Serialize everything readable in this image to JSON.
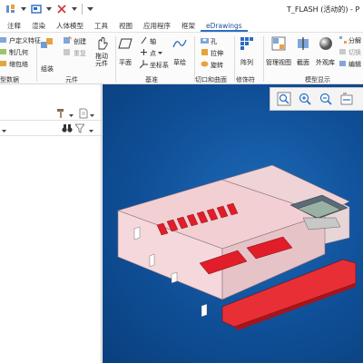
{
  "window": {
    "title": "T_FLASH (活动的) - P"
  },
  "tabs": [
    {
      "label": "注释",
      "active": false
    },
    {
      "label": "渲染",
      "active": false
    },
    {
      "label": "人体模型",
      "active": false
    },
    {
      "label": "工具",
      "active": false
    },
    {
      "label": "视图",
      "active": false
    },
    {
      "label": "应用程序",
      "active": false
    },
    {
      "label": "框架",
      "active": false
    },
    {
      "label": "eDrawings",
      "active": true
    }
  ],
  "ribbon": {
    "model_data": {
      "items": [
        "户定义特征",
        "制几何",
        "缩包络"
      ],
      "label": "型数据"
    },
    "assemble": {
      "label": "组装"
    },
    "components": {
      "create": "创建",
      "repeat": "重复",
      "drag": "拖动\n元件",
      "label": "元件"
    },
    "datum": {
      "plane": "平面",
      "axis": "轴",
      "point": "点",
      "csys": "坐标系",
      "sketch": "草绘",
      "label": "基准"
    },
    "cut_surface": {
      "hole": "孔",
      "extrude": "拉伸",
      "revolve": "旋转",
      "label": "切口和曲面"
    },
    "modifiers": {
      "pattern": "阵列",
      "label": "修饰符"
    },
    "model_display": {
      "manage_views": "管理视图",
      "section": "截面",
      "appearance": "外观库",
      "explode": "分解",
      "toggle": "切换",
      "edit_pos": "编辑",
      "label": "模型显示"
    }
  },
  "view_toolbar": {
    "icons": [
      "zoom-fit-icon",
      "zoom-in-icon",
      "zoom-out-icon",
      "repaint-icon"
    ]
  },
  "colors": {
    "viewport_bg": "#1258a4",
    "part_body": "#f4c8cc",
    "part_accent": "#e82f35",
    "active_tab": "#2a6fc9"
  }
}
